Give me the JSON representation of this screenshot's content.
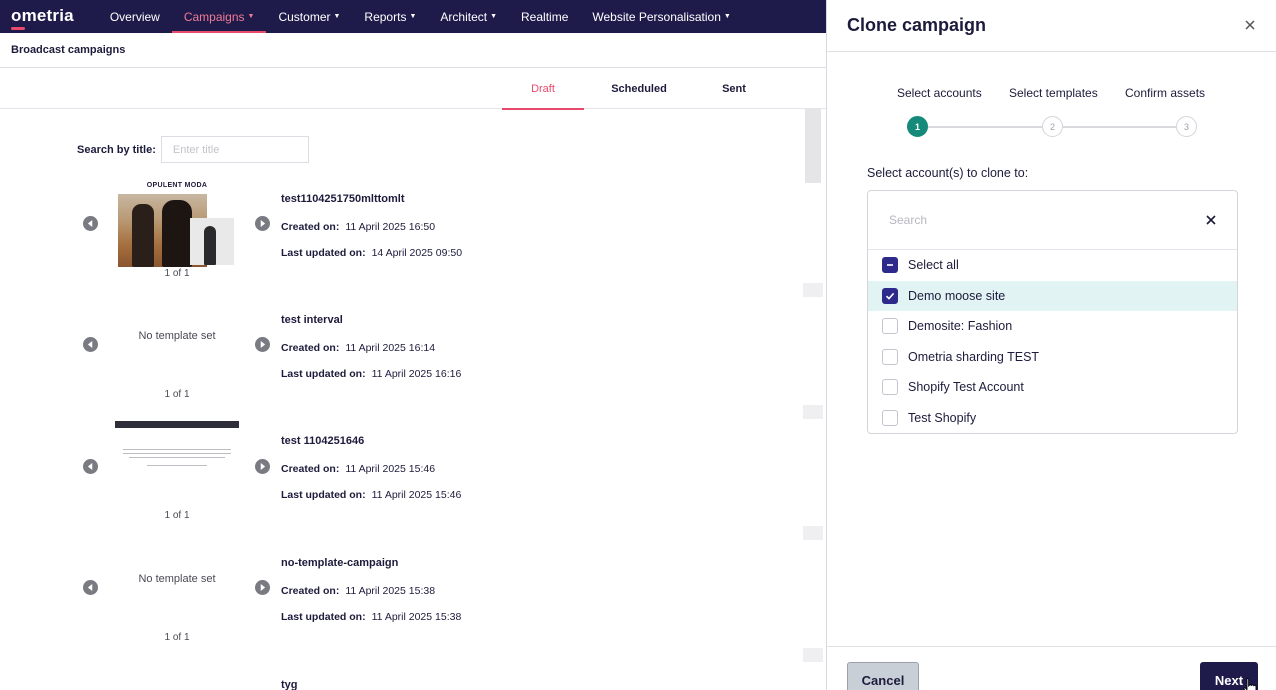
{
  "nav": {
    "logo": "ometria",
    "items": [
      {
        "label": "Overview",
        "dropdown": false,
        "active": false
      },
      {
        "label": "Campaigns",
        "dropdown": true,
        "active": true
      },
      {
        "label": "Customer",
        "dropdown": true,
        "active": false
      },
      {
        "label": "Reports",
        "dropdown": true,
        "active": false
      },
      {
        "label": "Architect",
        "dropdown": true,
        "active": false
      },
      {
        "label": "Realtime",
        "dropdown": false,
        "active": false
      },
      {
        "label": "Website Personalisation",
        "dropdown": true,
        "active": false
      }
    ]
  },
  "page": {
    "title": "Broadcast campaigns"
  },
  "tabs": [
    {
      "label": "Draft",
      "active": true
    },
    {
      "label": "Scheduled",
      "active": false
    },
    {
      "label": "Sent",
      "active": false
    }
  ],
  "search": {
    "label": "Search by title:",
    "placeholder": "Enter title"
  },
  "campaigns": [
    {
      "title": "test1104251750mlttomlt",
      "created_label": "Created on:",
      "created": "11 April 2025 16:50",
      "updated_label": "Last updated on:",
      "updated": "14 April 2025 09:50",
      "pager": "1 of 1",
      "template": "image",
      "brand": "OPULENT MODA"
    },
    {
      "title": "test interval",
      "created_label": "Created on:",
      "created": "11 April 2025 16:14",
      "updated_label": "Last updated on:",
      "updated": "11 April 2025 16:16",
      "pager": "1 of 1",
      "template": "none",
      "no_template_text": "No template set"
    },
    {
      "title": "test 1104251646",
      "created_label": "Created on:",
      "created": "11 April 2025 15:46",
      "updated_label": "Last updated on:",
      "updated": "11 April 2025 15:46",
      "pager": "1 of 1",
      "template": "text"
    },
    {
      "title": "no-template-campaign",
      "created_label": "Created on:",
      "created": "11 April 2025 15:38",
      "updated_label": "Last updated on:",
      "updated": "11 April 2025 15:38",
      "pager": "1 of 1",
      "template": "none",
      "no_template_text": "No template set"
    },
    {
      "title": "tyg"
    }
  ],
  "modal": {
    "title": "Clone campaign",
    "steps": [
      {
        "label": "Select accounts",
        "number": "1",
        "active": true
      },
      {
        "label": "Select templates",
        "number": "2",
        "active": false
      },
      {
        "label": "Confirm assets",
        "number": "3",
        "active": false
      }
    ],
    "select_label": "Select account(s) to clone to:",
    "search_placeholder": "Search",
    "select_all": {
      "label": "Select all",
      "state": "partial"
    },
    "accounts": [
      {
        "label": "Demo moose site",
        "checked": true
      },
      {
        "label": "Demosite: Fashion",
        "checked": false
      },
      {
        "label": "Ometria sharding TEST",
        "checked": false
      },
      {
        "label": "Shopify Test Account",
        "checked": false
      },
      {
        "label": "Test Shopify",
        "checked": false
      }
    ],
    "cancel_label": "Cancel",
    "next_label": "Next"
  },
  "colors": {
    "nav_bg": "#1e1b4b",
    "accent": "#e84a6b",
    "step_active": "#168a7a",
    "checkbox": "#2e2a8c",
    "row_selected": "#e2f3f4"
  }
}
